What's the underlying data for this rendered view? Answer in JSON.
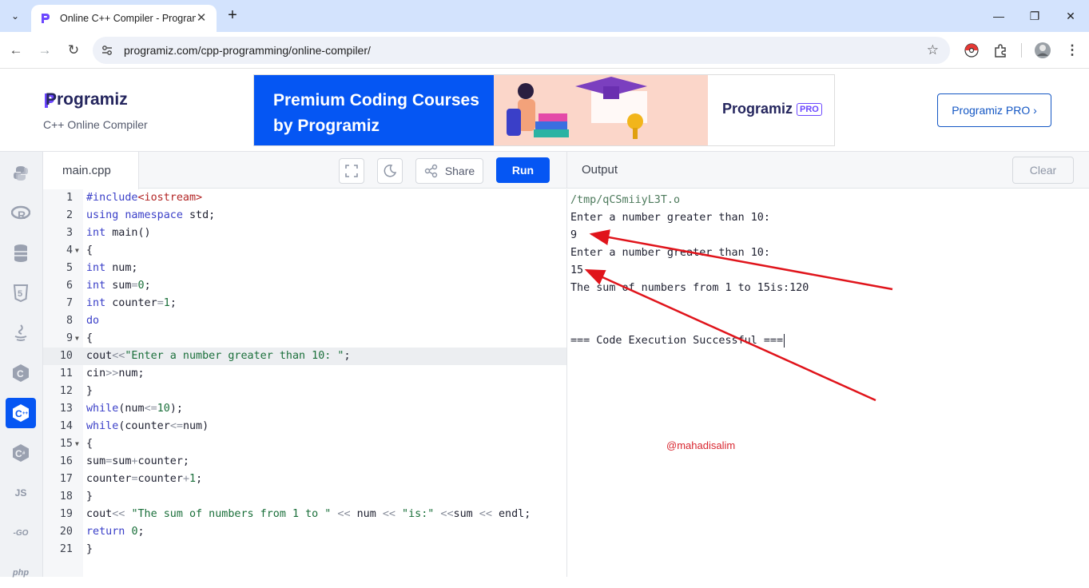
{
  "browser": {
    "tab_title": "Online C++ Compiler - Programiz",
    "url": "programiz.com/cpp-programming/online-compiler/",
    "new_tab_symbol": "+",
    "icons": [
      "tab-search-icon",
      "favicon",
      "close-icon",
      "new-tab-icon",
      "minimize-icon",
      "restore-icon",
      "window-close-icon",
      "back-icon",
      "forward-icon",
      "reload-icon",
      "site-info-icon",
      "bookmark-star-icon",
      "extension-icon",
      "puzzle-icon",
      "profile-avatar",
      "more-menu-icon"
    ]
  },
  "header": {
    "logo": "Programiz",
    "subtitle": "C++ Online Compiler",
    "banner_text": "Premium Coding Courses by Programiz",
    "banner_brand": "Programiz",
    "banner_badge": "PRO",
    "pro_button": "Programiz PRO ›"
  },
  "rail": {
    "items": [
      {
        "name": "python-icon",
        "glyph": "🐍"
      },
      {
        "name": "r-icon",
        "glyph": "R"
      },
      {
        "name": "sql-icon",
        "glyph": "🗄"
      },
      {
        "name": "html-icon",
        "glyph": "5"
      },
      {
        "name": "java-icon",
        "glyph": "☕"
      },
      {
        "name": "c-icon",
        "glyph": "C"
      },
      {
        "name": "cpp-icon",
        "glyph": "C"
      },
      {
        "name": "csharp-icon",
        "glyph": "C"
      },
      {
        "name": "javascript-icon",
        "glyph": "JS"
      },
      {
        "name": "go-icon",
        "glyph": "GO"
      },
      {
        "name": "php-icon",
        "glyph": "php"
      }
    ],
    "active": "cpp-icon"
  },
  "editor": {
    "file_name": "main.cpp",
    "share_label": "Share",
    "run_label": "Run",
    "highlighted_line": 10,
    "lines": [
      "#include<iostream>",
      "using namespace std;",
      "int main()",
      "{",
      "int num;",
      "int sum=0;",
      "int counter=1;",
      "do",
      "{",
      "cout<<\"Enter a number greater than 10: \";",
      "cin>>num;",
      "}",
      "while(num<=10);",
      "while(counter<=num)",
      "{",
      "sum=sum+counter;",
      "counter=counter+1;",
      "}",
      "cout<< \"The sum of numbers from 1 to \" << num << \"is:\" <<sum << endl;",
      "return 0;",
      "}"
    ],
    "fold_lines": [
      4,
      9,
      15
    ]
  },
  "output": {
    "title": "Output",
    "clear_label": "Clear",
    "lines": [
      "/tmp/qCSmiiyL3T.o",
      "Enter a number greater than 10:",
      "9",
      "Enter a number greater than 10:",
      "15",
      "The sum of numbers from 1 to 15is:120",
      "",
      "",
      "=== Code Execution Successful ==="
    ]
  },
  "annotation": {
    "watermark": "@mahadisalim",
    "arrow_color": "#e0141b"
  }
}
